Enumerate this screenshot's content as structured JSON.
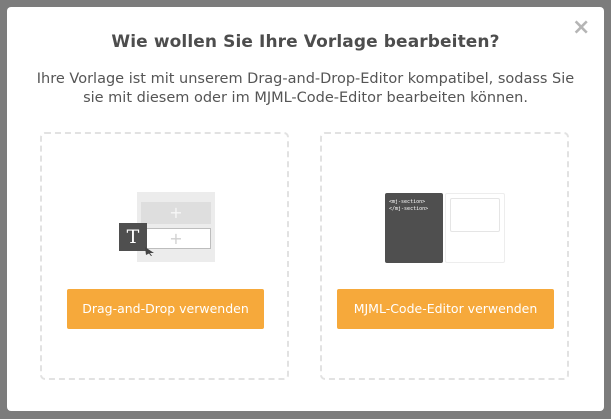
{
  "dialog": {
    "title": "Wie wollen Sie Ihre Vorlage bearbeiten?",
    "description": "Ihre Vorlage ist mit unserem Drag-and-Drop-Editor kompatibel, sodass Sie sie mit diesem oder im MJML-Code-Editor bearbeiten können.",
    "close_icon": "close-icon",
    "close_glyph": "×"
  },
  "options": {
    "dnd": {
      "button_label": "Drag-and-Drop verwenden",
      "illustration_icon": "drag-and-drop-illustration",
      "text_block_glyph": "T",
      "plus_glyph": "+"
    },
    "mjml": {
      "button_label": "MJML-Code-Editor verwenden",
      "illustration_icon": "code-editor-illustration",
      "code_line_1": "<mj-section>",
      "code_line_2": "</mj-section>"
    }
  },
  "colors": {
    "accent": "#f6a93b",
    "overlay": "#7c7c7c",
    "title_text": "#4d4d4d",
    "dark_block": "#4f4f4f"
  }
}
